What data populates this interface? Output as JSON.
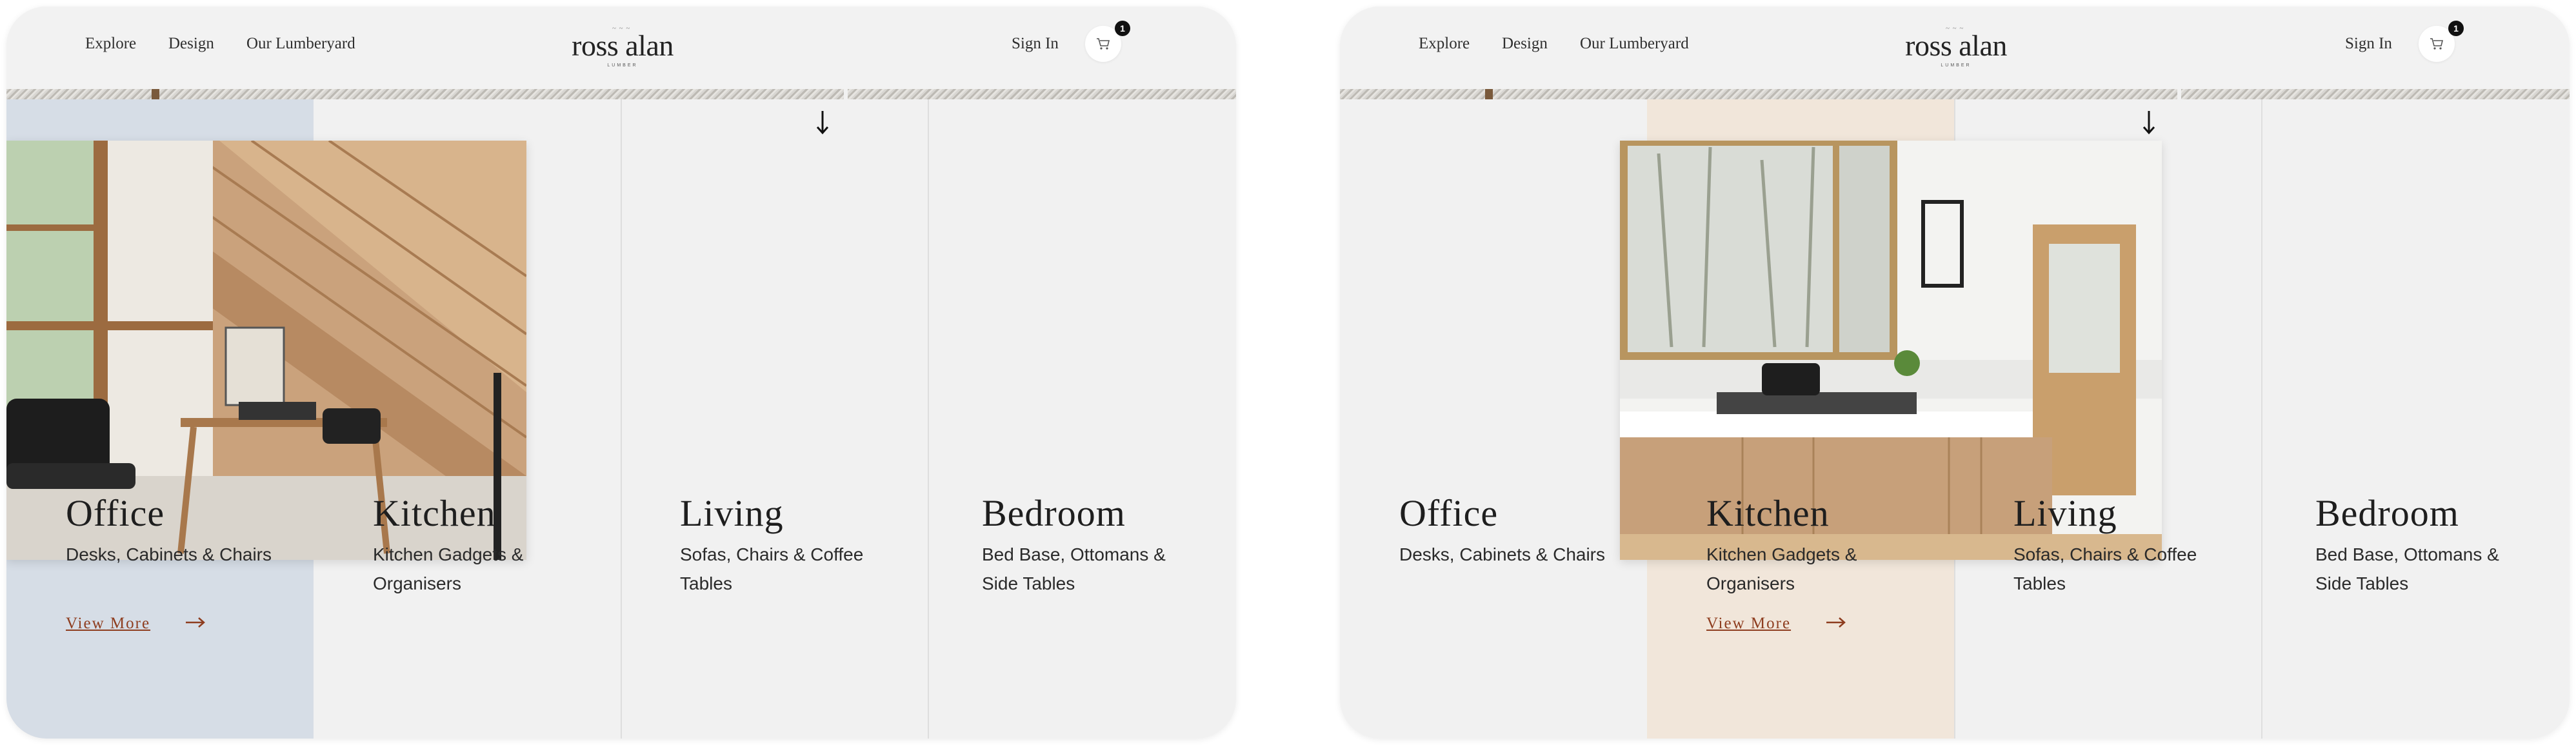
{
  "nav": {
    "explore": "Explore",
    "design": "Design",
    "lumberyard": "Our Lumberyard",
    "sign_in": "Sign In",
    "cart_count": "1"
  },
  "logo": {
    "text": "ross alan",
    "sub": "LUMBER"
  },
  "categories": [
    {
      "title": "Office",
      "subtitle": "Desks, Cabinets & Chairs"
    },
    {
      "title": "Kitchen",
      "subtitle": "Kitchen Gadgets & Organisers"
    },
    {
      "title": "Living",
      "subtitle": "Sofas, Chairs & Coffee Tables"
    },
    {
      "title": "Bedroom",
      "subtitle": "Bed Base, Ottomans & Side Tables"
    }
  ],
  "view_more": "View More",
  "colors": {
    "panel_bg": "#f1f1f1",
    "office_highlight": "#d6dde6",
    "kitchen_highlight": "#f1e6da",
    "link_accent": "#8e3d1f"
  },
  "icons": {
    "cart": "cart-icon",
    "arrow_down": "arrow-down-icon",
    "arrow_right": "arrow-right-icon"
  },
  "panels": [
    {
      "active_category": "Office",
      "image": "office-photo"
    },
    {
      "active_category": "Kitchen",
      "image": "kitchen-photo"
    }
  ]
}
